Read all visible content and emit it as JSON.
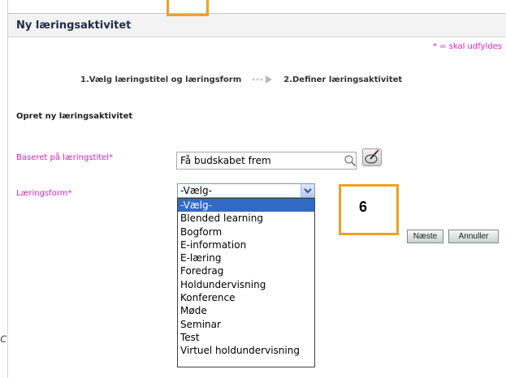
{
  "header": {
    "title": "Ny læringsaktivitet"
  },
  "required_note": "* = skal udfyldes",
  "steps": [
    {
      "label": "1.Vælg læringstitel og læringsform"
    },
    {
      "label": "2.Definer læringsaktivitet"
    }
  ],
  "section_title": "Opret ny læringsaktivitet",
  "form": {
    "basis_label": "Baseret på læringstitel*",
    "title_value": "Få budskabet frem",
    "form_label": "Læringsform*",
    "form_selected": "-Vælg-",
    "form_options": [
      "-Vælg-",
      "Blended learning",
      "Bogform",
      "E-information",
      "E-læring",
      "Foredrag",
      "Holdundervisning",
      "Konference",
      "Møde",
      "Seminar",
      "Test",
      "Virtuel holdundervisning"
    ]
  },
  "buttons": {
    "next": "Næste",
    "cancel": "Annuller"
  },
  "callout": {
    "number": "6"
  },
  "fragment_text": "c",
  "colors": {
    "accent_pink": "#e020c0",
    "highlight_orange": "#f0a020",
    "selection_blue": "#316ac5"
  },
  "icons": {
    "search": "search-icon",
    "edit": "edit-icon",
    "dropdown": "chevron-down-icon",
    "arrow": "step-arrow-icon"
  }
}
